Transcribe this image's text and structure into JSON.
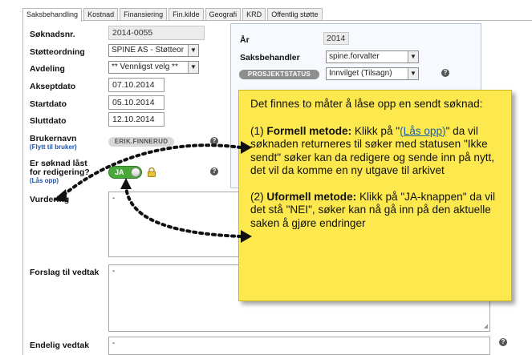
{
  "tabs": [
    "Saksbehandling",
    "Kostnad",
    "Finansiering",
    "Fin.kilde",
    "Geografi",
    "KRD",
    "Offentlig støtte"
  ],
  "form": {
    "soknadsnr": {
      "label": "Søknadsnr.",
      "value": "2014-0055"
    },
    "stotteordning": {
      "label": "Støtteordning",
      "value": "SPINE AS - Støtteor"
    },
    "avdeling": {
      "label": "Avdeling",
      "value": "** Vennligst velg **"
    },
    "akseptdato": {
      "label": "Akseptdato",
      "value": "07.10.2014"
    },
    "startdato": {
      "label": "Startdato",
      "value": "05.10.2014"
    },
    "sluttdato": {
      "label": "Sluttdato",
      "value": "12.10.2014"
    },
    "brukernavn": {
      "label": "Brukernavn",
      "sublabel": "(Flytt til bruker)",
      "value": "ERIK.FINNERUD"
    },
    "last": {
      "label_line1": "Er søknad låst",
      "label_line2": "for redigering?",
      "sublabel": "(Lås opp)",
      "toggle": "JA"
    },
    "vurdering": {
      "label": "Vurdering",
      "value": "-"
    },
    "forslag": {
      "label": "Forslag til vedtak",
      "value": "-"
    },
    "endelig": {
      "label": "Endelig vedtak",
      "value": "-"
    }
  },
  "right": {
    "ar": {
      "label": "År",
      "value": "2014"
    },
    "saksbehandler": {
      "label": "Saksbehandler",
      "value": "spine.forvalter"
    },
    "prosjektstatus": {
      "label": "PROSJEKTSTATUS",
      "value": "Innvilget (Tilsagn)"
    }
  },
  "help_glyph": "?",
  "select_arrow": "▼",
  "callout": {
    "intro": "Det finnes to måter å låse opp en sendt søknad:",
    "m1_prefix": "(1) ",
    "m1_title": "Formell metode:",
    "m1_a": " Klikk på \"",
    "m1_link": "(Lås opp)",
    "m1_b": "\" da vil søknaden returneres til søker med statusen \"Ikke sendt\" søker kan da redigere og sende inn på nytt, det vil da komme en ny utgave til arkivet",
    "m2_prefix": "(2) ",
    "m2_title": "Uformell metode:",
    "m2_text": " Klikk på \"JA-knappen\" da vil det stå \"NEI\", søker kan nå gå inn på den aktuelle saken å gjøre endringer"
  },
  "colors": {
    "callout_bg": "#fde94e",
    "toggle_on": "#4aa83a",
    "link": "#1f52a8"
  }
}
